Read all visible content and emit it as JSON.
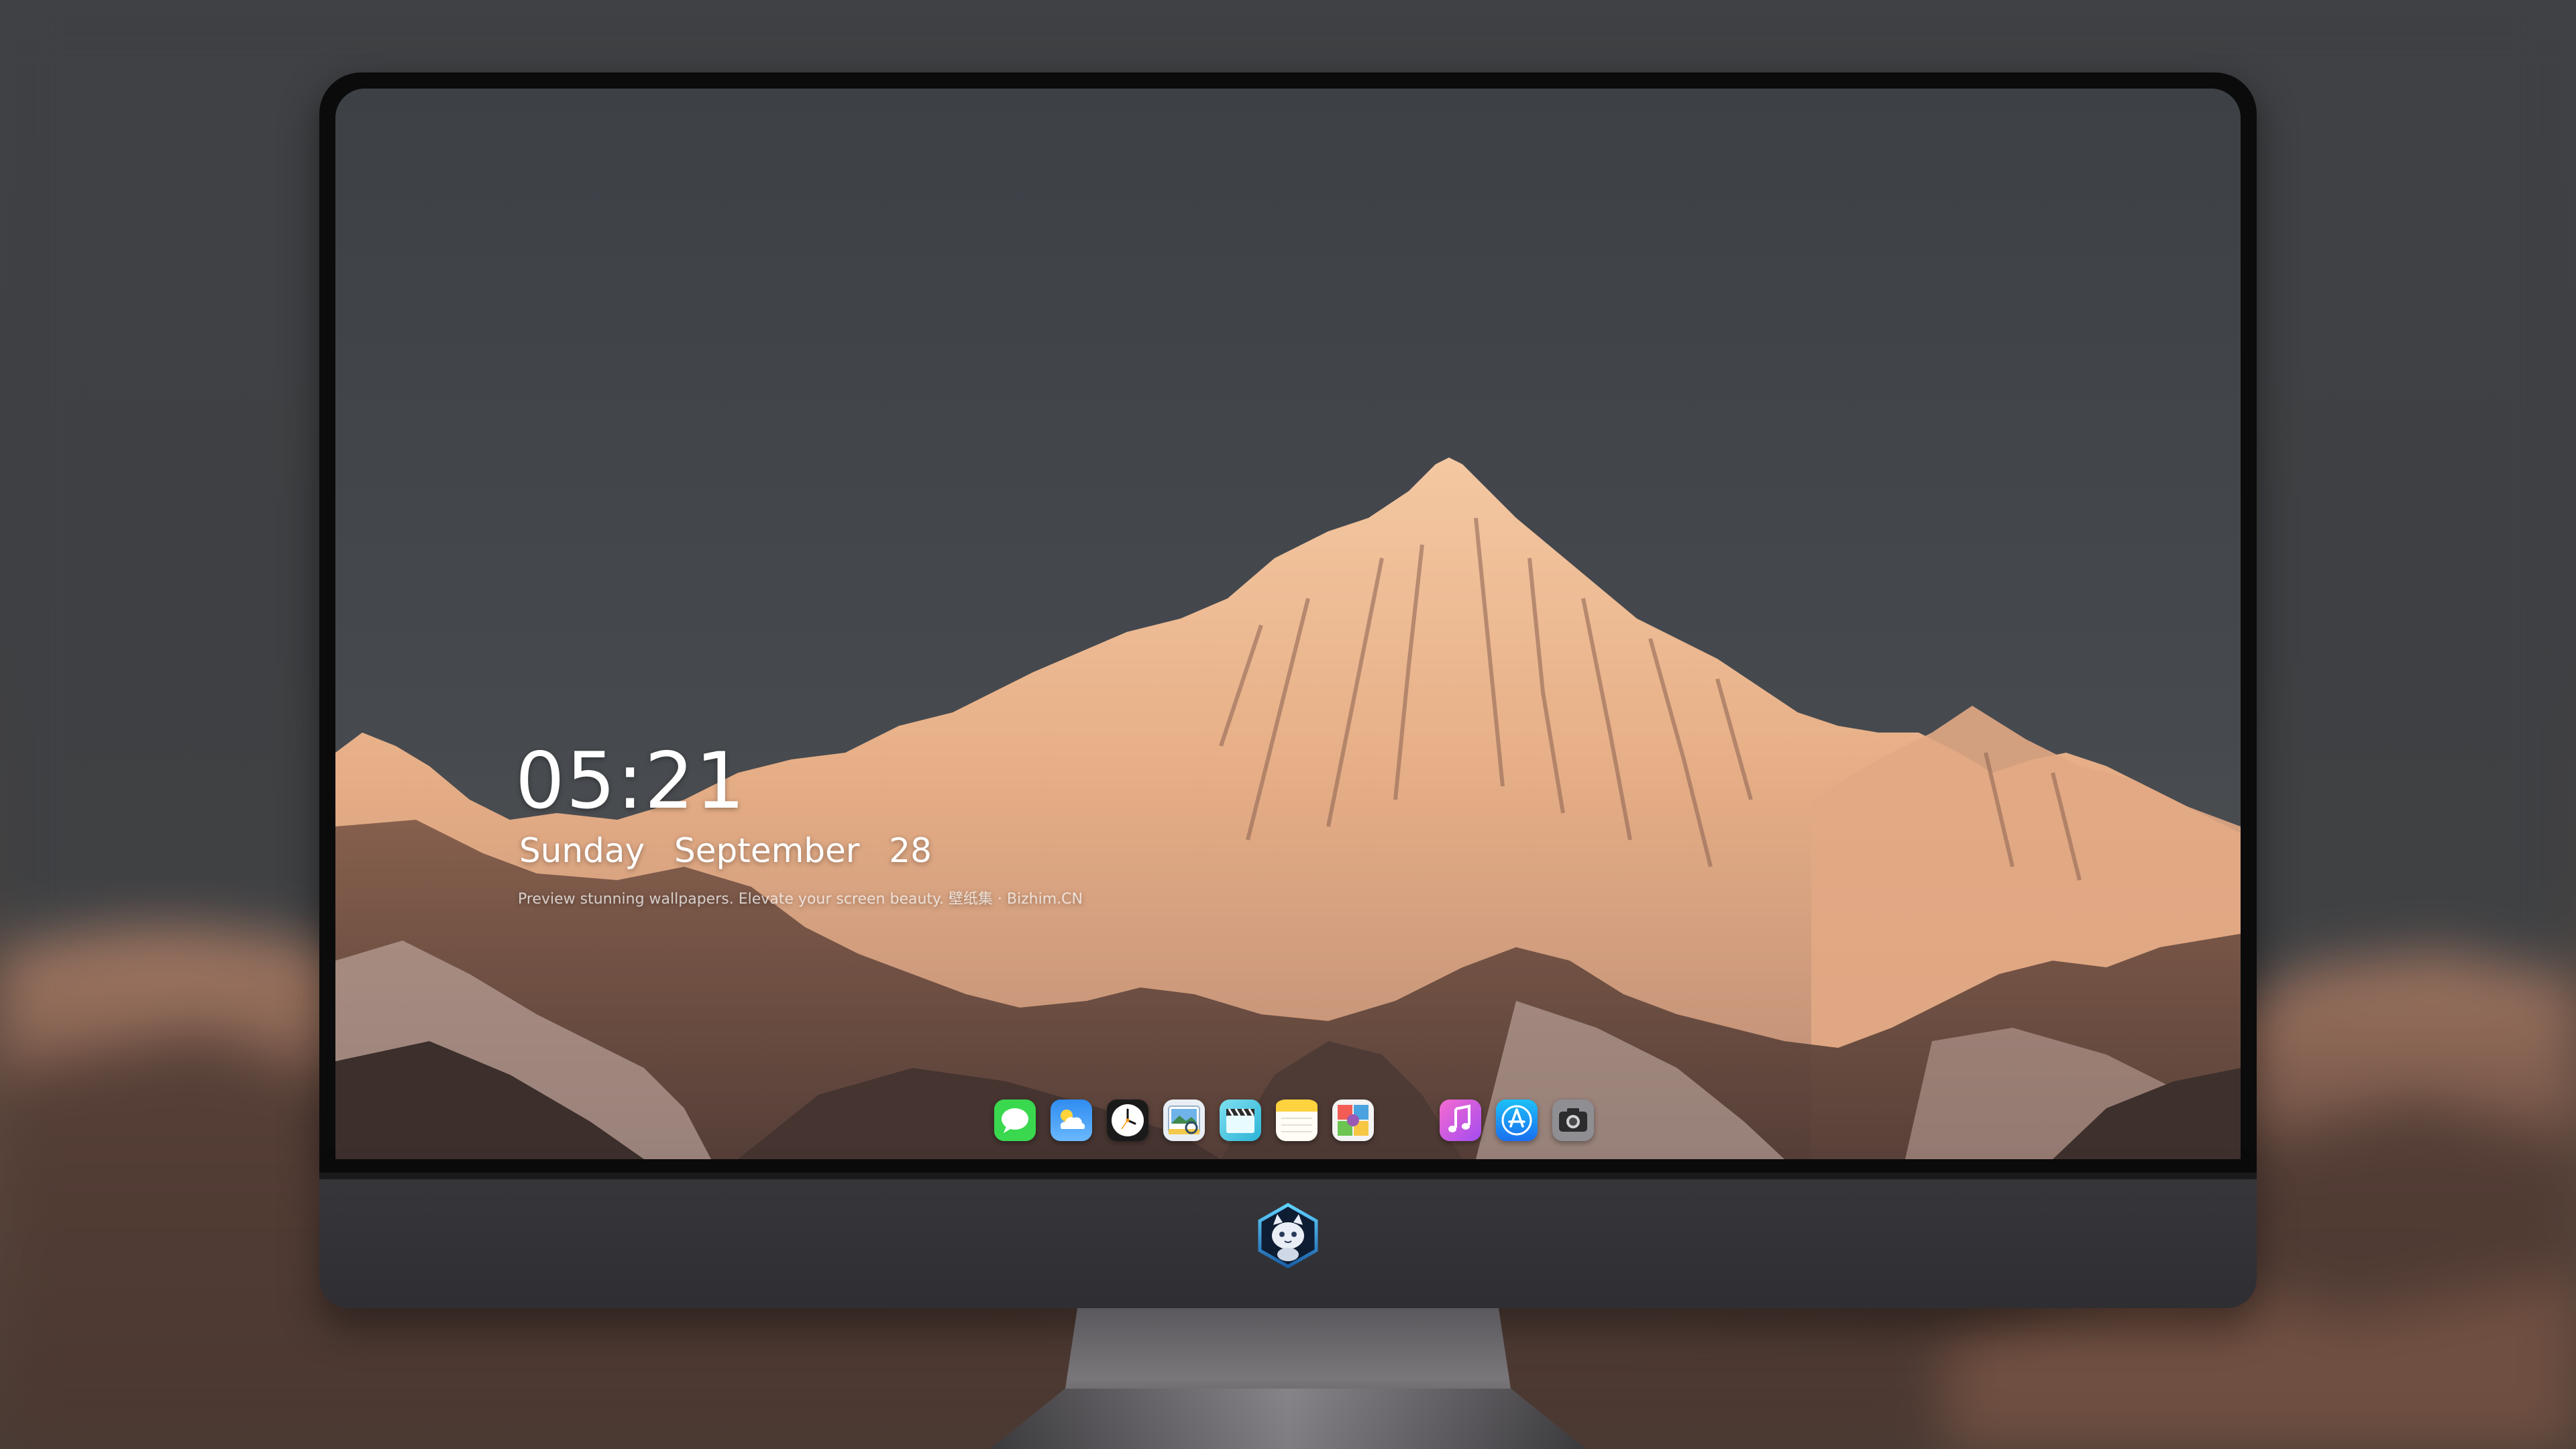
{
  "lockscreen": {
    "time": "05:21",
    "day": "Sunday",
    "month": "September",
    "date": "28",
    "caption": "Preview stunning wallpapers. Elevate your screen beauty. 壁纸集 · Bizhim.CN"
  },
  "dock": {
    "left_icons": [
      "messages-icon",
      "weather-icon",
      "clock-icon",
      "preview-icon",
      "claquette-icon",
      "notes-icon",
      "photo-booth-icon"
    ],
    "right_icons": [
      "music-icon",
      "app-store-icon",
      "camera-icon"
    ]
  },
  "monitor": {
    "logo_icon": "cat-mascot-logo-icon"
  },
  "colors": {
    "bezel": "#0b0b0c",
    "chin": "#333236",
    "sky": "#43474c",
    "mountain_light": "#e8b089",
    "mountain_shadow": "#6a4a3e"
  }
}
